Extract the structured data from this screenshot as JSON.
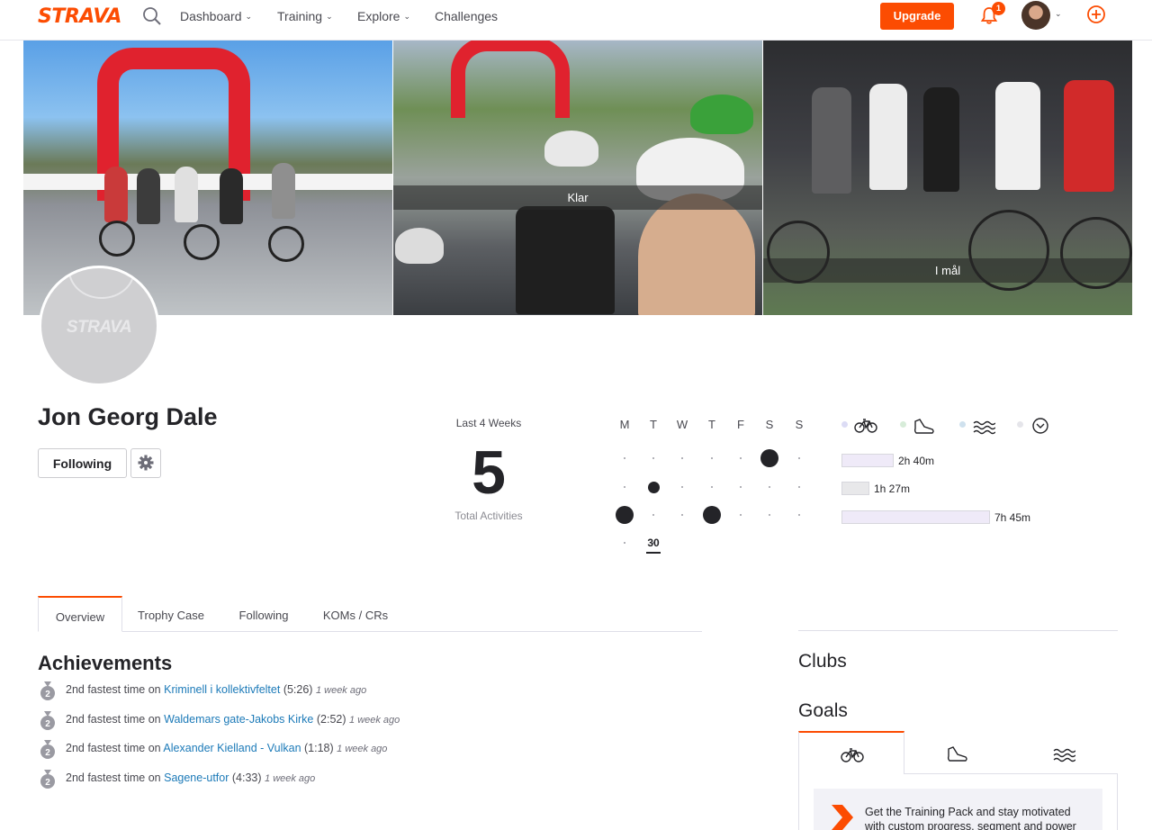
{
  "header": {
    "logo": "STRAVA",
    "nav": [
      {
        "label": "Dashboard",
        "has_menu": true
      },
      {
        "label": "Training",
        "has_menu": true
      },
      {
        "label": "Explore",
        "has_menu": true
      },
      {
        "label": "Challenges",
        "has_menu": false
      }
    ],
    "upgrade_label": "Upgrade",
    "notification_count": "1",
    "icons": [
      "search-icon",
      "bell-icon",
      "user-avatar",
      "chevron-down-icon",
      "add-circle-icon"
    ],
    "accent_color": "#fc4c02"
  },
  "cover_photos": [
    {
      "caption": ""
    },
    {
      "caption": "Klar"
    },
    {
      "caption": "I mål"
    }
  ],
  "profile": {
    "avatar_watermark": "STRAVA",
    "name": "Jon Georg Dale",
    "following_label": "Following",
    "settings_icon": "gear-icon"
  },
  "stats": {
    "period_label": "Last 4 Weeks",
    "total_activities": "5",
    "total_label": "Total Activities",
    "days": [
      "M",
      "T",
      "W",
      "T",
      "F",
      "S",
      "S"
    ],
    "current_date": "30",
    "activity_grid": [
      [
        0,
        0,
        0,
        0,
        0,
        2,
        0
      ],
      [
        0,
        1,
        0,
        0,
        0,
        0,
        0
      ],
      [
        2,
        0,
        0,
        2,
        0,
        0,
        0
      ],
      [
        0,
        0,
        null,
        null,
        null,
        null,
        null
      ]
    ],
    "sports": [
      {
        "icon": "bike-icon",
        "color": "#dcdcf5"
      },
      {
        "icon": "run-shoe-icon",
        "color": "#d7ecd9"
      },
      {
        "icon": "swim-icon",
        "color": "#cfe1ee"
      },
      {
        "icon": "other-check-icon",
        "color": "#e5e5ea"
      }
    ],
    "time_bars": [
      {
        "label": "2h 40m",
        "fill": "#efeaf8",
        "fraction": 0.35
      },
      {
        "label": "1h 27m",
        "fill": "#e8e8ea",
        "fraction": 0.19
      },
      {
        "label": "7h 45m",
        "fill": "#efeaf8",
        "fraction": 1.0
      }
    ]
  },
  "tabs": [
    {
      "label": "Overview",
      "active": true
    },
    {
      "label": "Trophy Case",
      "active": false
    },
    {
      "label": "Following",
      "active": false
    },
    {
      "label": "KOMs / CRs",
      "active": false
    }
  ],
  "achievements": {
    "title": "Achievements",
    "items": [
      {
        "medal": "2",
        "prefix": "2nd fastest time on",
        "segment": "Kriminell i kollektivfeltet",
        "time": "(5:26)",
        "ago": "1 week ago"
      },
      {
        "medal": "2",
        "prefix": "2nd fastest time on",
        "segment": "Waldemars gate-Jakobs Kirke",
        "time": "(2:52)",
        "ago": "1 week ago"
      },
      {
        "medal": "2",
        "prefix": "2nd fastest time on",
        "segment": "Alexander Kielland - Vulkan",
        "time": "(1:18)",
        "ago": "1 week ago"
      },
      {
        "medal": "2",
        "prefix": "2nd fastest time on",
        "segment": "Sagene-utfor",
        "time": "(4:33)",
        "ago": "1 week ago"
      }
    ]
  },
  "sidebar": {
    "clubs_title": "Clubs",
    "goals_title": "Goals",
    "goal_tabs": [
      {
        "icon": "bike-icon",
        "active": true
      },
      {
        "icon": "run-shoe-icon",
        "active": false
      },
      {
        "icon": "swim-icon",
        "active": false
      }
    ],
    "promo_text": "Get the Training Pack and stay motivated with custom progress, segment and power"
  }
}
